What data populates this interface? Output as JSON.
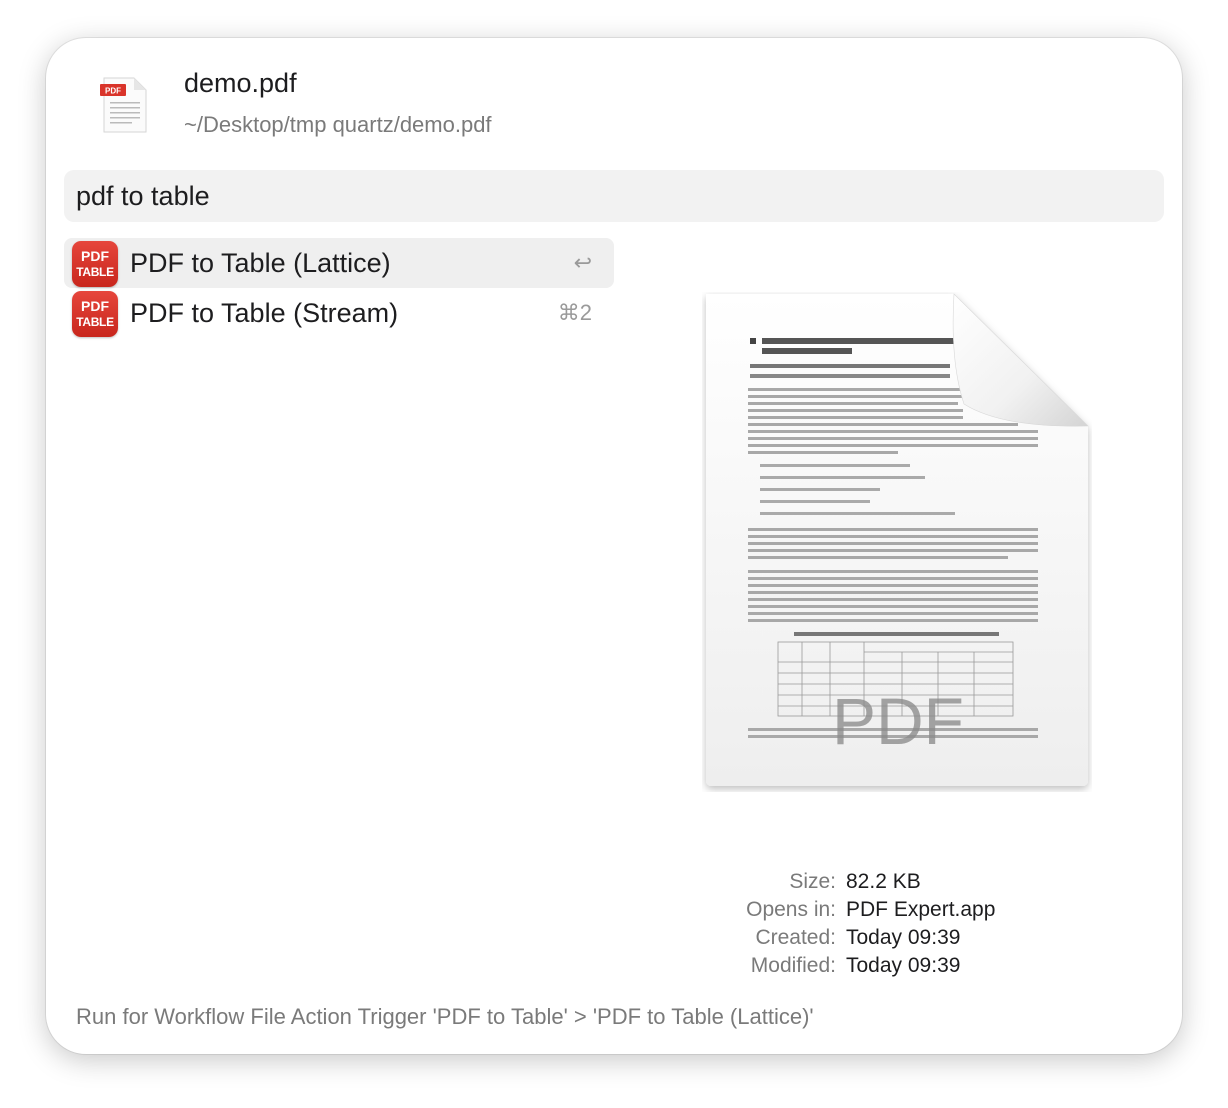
{
  "header": {
    "file_name": "demo.pdf",
    "file_path": "~/Desktop/tmp quartz/demo.pdf",
    "file_icon_badge": "PDF"
  },
  "search": {
    "value": "pdf to table"
  },
  "results": [
    {
      "label": "PDF to Table (Lattice)",
      "shortcut": "↩",
      "icon_line1": "PDF",
      "icon_line2": "TABLE",
      "selected": true
    },
    {
      "label": "PDF to Table (Stream)",
      "shortcut": "⌘2",
      "icon_line1": "PDF",
      "icon_line2": "TABLE",
      "selected": false
    }
  ],
  "preview": {
    "watermark": "PDF"
  },
  "info": [
    {
      "key": "Size:",
      "value": "82.2 KB"
    },
    {
      "key": "Opens in:",
      "value": "PDF Expert.app"
    },
    {
      "key": "Created:",
      "value": "Today 09:39"
    },
    {
      "key": "Modified:",
      "value": "Today 09:39"
    }
  ],
  "footer": {
    "text": "Run for Workflow File Action Trigger 'PDF to Table' > 'PDF to Table (Lattice)'"
  },
  "colors": {
    "accent_red": "#d9342a",
    "selected_bg": "#efefef",
    "search_bg": "#f2f2f2"
  }
}
